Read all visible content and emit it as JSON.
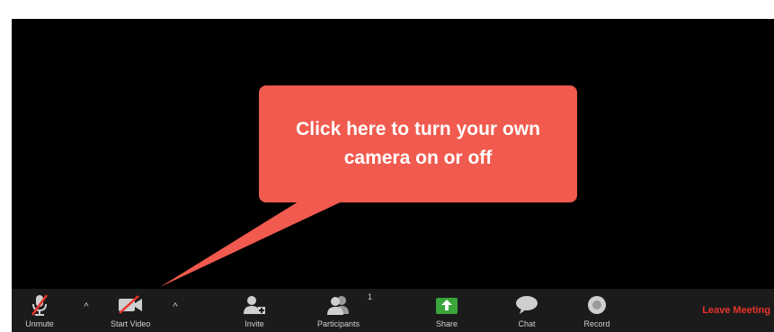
{
  "callout": {
    "text": "Click here to turn your own camera on or off"
  },
  "toolbar": {
    "unmute_label": "Unmute",
    "start_video_label": "Start Video",
    "invite_label": "Invite",
    "participants_label": "Participants",
    "participants_count": "1",
    "share_label": "Share",
    "chat_label": "Chat",
    "record_label": "Record",
    "leave_label": "Leave Meeting"
  },
  "colors": {
    "callout_bg": "#f15a4e",
    "toolbar_bg": "#1b1b1b",
    "leave_text": "#e8332a",
    "share_green": "#3aa53a"
  },
  "icons": {
    "unmute": "microphone-muted-icon",
    "start_video": "video-camera-off-icon",
    "invite": "invite-user-icon",
    "participants": "participants-icon",
    "share": "share-screen-icon",
    "chat": "chat-bubble-icon",
    "record": "record-icon"
  }
}
